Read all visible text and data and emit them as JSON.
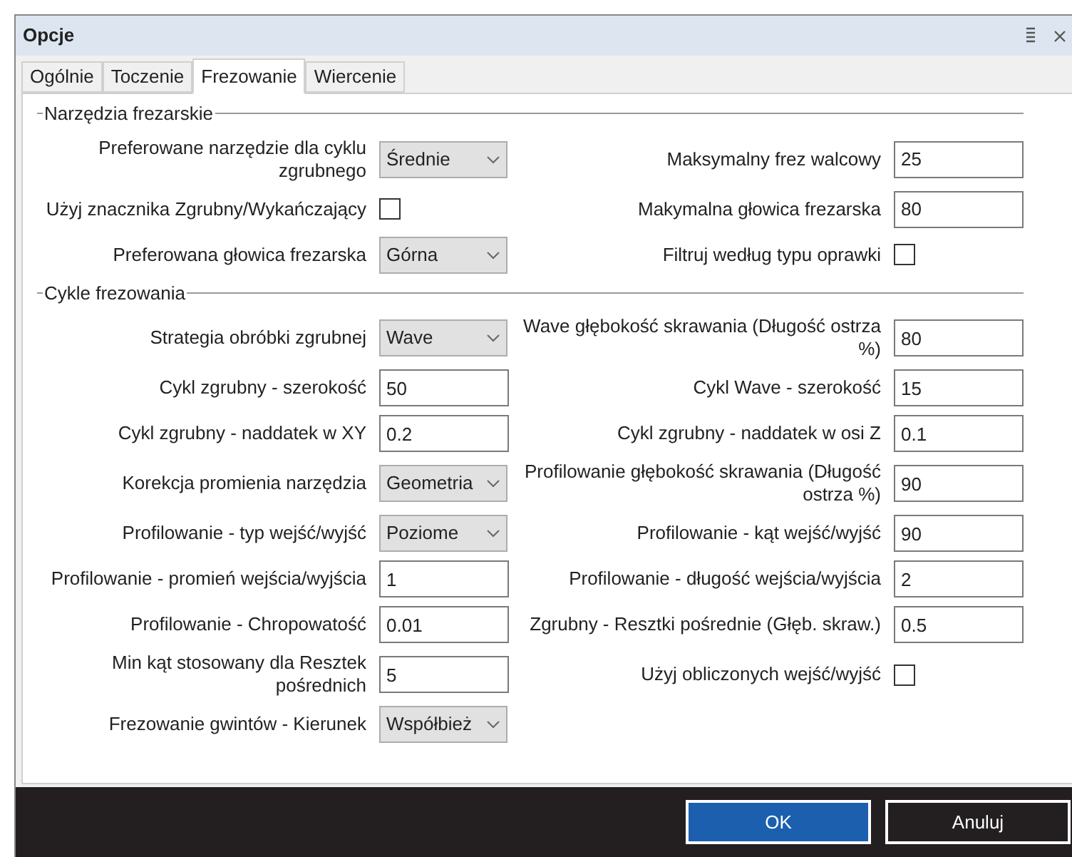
{
  "window": {
    "title": "Opcje"
  },
  "tabs": [
    {
      "label": "Ogólnie",
      "selected": false
    },
    {
      "label": "Toczenie",
      "selected": false
    },
    {
      "label": "Frezowanie",
      "selected": true
    },
    {
      "label": "Wiercenie",
      "selected": false
    }
  ],
  "sections": [
    {
      "title": "Narzędzia frezarskie",
      "rows": [
        {
          "left": {
            "kind": "dropdown",
            "label": "Preferowane narzędzie dla cyklu zgrubnego",
            "value": "Średnie"
          },
          "right": {
            "kind": "input",
            "label": "Maksymalny frez walcowy",
            "value": "25"
          }
        },
        {
          "left": {
            "kind": "checkbox",
            "label": "Użyj znacznika Zgrubny/Wykańczający",
            "checked": false
          },
          "right": {
            "kind": "input",
            "label": "Makymalna głowica frezarska",
            "value": "80"
          }
        },
        {
          "left": {
            "kind": "dropdown",
            "label": "Preferowana głowica frezarska",
            "value": "Górna"
          },
          "right": {
            "kind": "checkbox",
            "label": "Filtruj według typu oprawki",
            "checked": false
          }
        }
      ]
    },
    {
      "title": "Cykle frezowania",
      "rows": [
        {
          "left": {
            "kind": "dropdown",
            "label": "Strategia obróbki zgrubnej",
            "value": "Wave"
          },
          "right": {
            "kind": "input",
            "label": "Wave głębokość skrawania (Długość ostrza %)",
            "value": "80"
          }
        },
        {
          "left": {
            "kind": "input",
            "label": "Cykl zgrubny - szerokość",
            "value": "50"
          },
          "right": {
            "kind": "input",
            "label": "Cykl Wave - szerokość",
            "value": "15"
          }
        },
        {
          "left": {
            "kind": "input",
            "label": "Cykl zgrubny - naddatek w XY",
            "value": "0.2"
          },
          "right": {
            "kind": "input",
            "label": "Cykl zgrubny - naddatek w osi Z",
            "value": "0.1"
          }
        },
        {
          "left": {
            "kind": "dropdown",
            "label": "Korekcja promienia narzędzia",
            "value": "Geometria"
          },
          "right": {
            "kind": "input",
            "label": "Profilowanie głębokość skrawania (Długość ostrza %)",
            "value": "90"
          }
        },
        {
          "left": {
            "kind": "dropdown",
            "label": "Profilowanie - typ wejść/wyjść",
            "value": "Poziome"
          },
          "right": {
            "kind": "input",
            "label": "Profilowanie - kąt wejść/wyjść",
            "value": "90"
          }
        },
        {
          "left": {
            "kind": "input",
            "label": "Profilowanie - promień wejścia/wyjścia",
            "value": "1"
          },
          "right": {
            "kind": "input",
            "label": "Profilowanie - długość wejścia/wyjścia",
            "value": "2"
          }
        },
        {
          "left": {
            "kind": "input",
            "label": "Profilowanie - Chropowatość",
            "value": "0.01"
          },
          "right": {
            "kind": "input",
            "label": "Zgrubny - Resztki pośrednie (Głęb. skraw.)",
            "value": "0.5"
          }
        },
        {
          "left": {
            "kind": "input",
            "label": "Min kąt stosowany dla Resztek pośrednich",
            "value": "5"
          },
          "right": {
            "kind": "checkbox",
            "label": "Użyj obliczonych wejść/wyjść",
            "checked": false
          }
        },
        {
          "left": {
            "kind": "dropdown",
            "label": "Frezowanie gwintów - Kierunek",
            "value": "Współbież"
          }
        }
      ]
    }
  ],
  "buttons": [
    {
      "label": "OK",
      "kind": "primary"
    },
    {
      "label": "Anuluj",
      "kind": "secondary"
    }
  ]
}
